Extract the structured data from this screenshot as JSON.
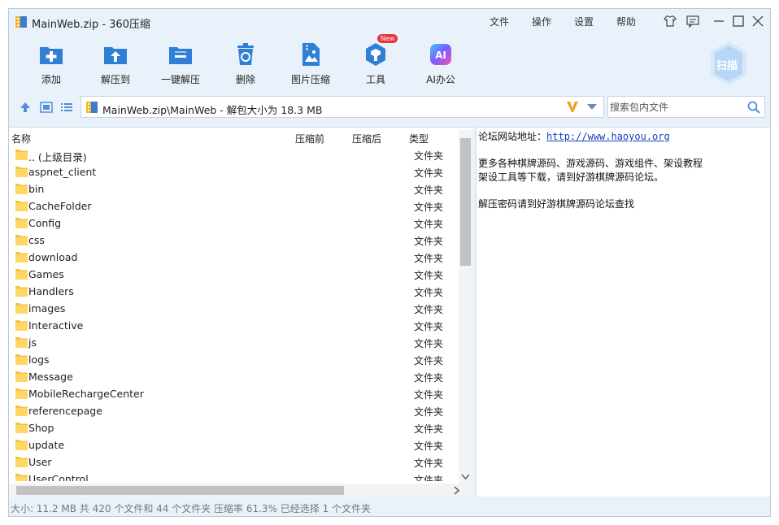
{
  "window": {
    "title": "MainWeb.zip - 360压缩",
    "menu": [
      "文件",
      "操作",
      "设置",
      "帮助"
    ]
  },
  "toolbar": {
    "items": [
      {
        "label": "添加",
        "icon": "add-icon"
      },
      {
        "label": "解压到",
        "icon": "extract-to-icon"
      },
      {
        "label": "一键解压",
        "icon": "one-click-extract-icon"
      },
      {
        "label": "删除",
        "icon": "delete-icon"
      },
      {
        "label": "图片压缩",
        "icon": "image-compress-icon"
      },
      {
        "label": "工具",
        "icon": "tools-icon"
      },
      {
        "label": "AI办公",
        "icon": "ai-office-icon"
      }
    ],
    "new_badge": "New",
    "scan_label": "扫描"
  },
  "address": {
    "path": "MainWeb.zip\\MainWeb - 解包大小为 18.3 MB"
  },
  "search": {
    "placeholder": "搜索包内文件"
  },
  "columns": {
    "name": "名称",
    "before": "压缩前",
    "after": "压缩后",
    "type": "类型"
  },
  "files": [
    {
      "name": ".. (上级目录)",
      "type": "文件夹"
    },
    {
      "name": "aspnet_client",
      "type": "文件夹"
    },
    {
      "name": "bin",
      "type": "文件夹"
    },
    {
      "name": "CacheFolder",
      "type": "文件夹"
    },
    {
      "name": "Config",
      "type": "文件夹"
    },
    {
      "name": "css",
      "type": "文件夹"
    },
    {
      "name": "download",
      "type": "文件夹"
    },
    {
      "name": "Games",
      "type": "文件夹"
    },
    {
      "name": "Handlers",
      "type": "文件夹"
    },
    {
      "name": "images",
      "type": "文件夹"
    },
    {
      "name": "Interactive",
      "type": "文件夹"
    },
    {
      "name": "js",
      "type": "文件夹"
    },
    {
      "name": "logs",
      "type": "文件夹"
    },
    {
      "name": "Message",
      "type": "文件夹"
    },
    {
      "name": "MobileRechargeCenter",
      "type": "文件夹"
    },
    {
      "name": "referencepage",
      "type": "文件夹"
    },
    {
      "name": "Shop",
      "type": "文件夹"
    },
    {
      "name": "update",
      "type": "文件夹"
    },
    {
      "name": "User",
      "type": "文件夹"
    },
    {
      "name": "UserControl",
      "type": "文件夹"
    }
  ],
  "info": {
    "forum_label": "论坛网站地址：",
    "forum_url": "http://www.haoyou.org",
    "line2": "更多各种棋牌源码、游戏源码、游戏组件、架设教程",
    "line3": "架设工具等下载，请到好游棋牌源码论坛。",
    "line4": "解压密码请到好游棋牌源码论坛查找"
  },
  "status": {
    "text": "大小: 11.2 MB 共 420 个文件和 44 个文件夹 压缩率 61.3% 已经选择 1 个文件夹"
  },
  "colors": {
    "accent": "#2f7fd6",
    "window_bg": "#e9f2fb",
    "link": "#1c3dbf"
  }
}
